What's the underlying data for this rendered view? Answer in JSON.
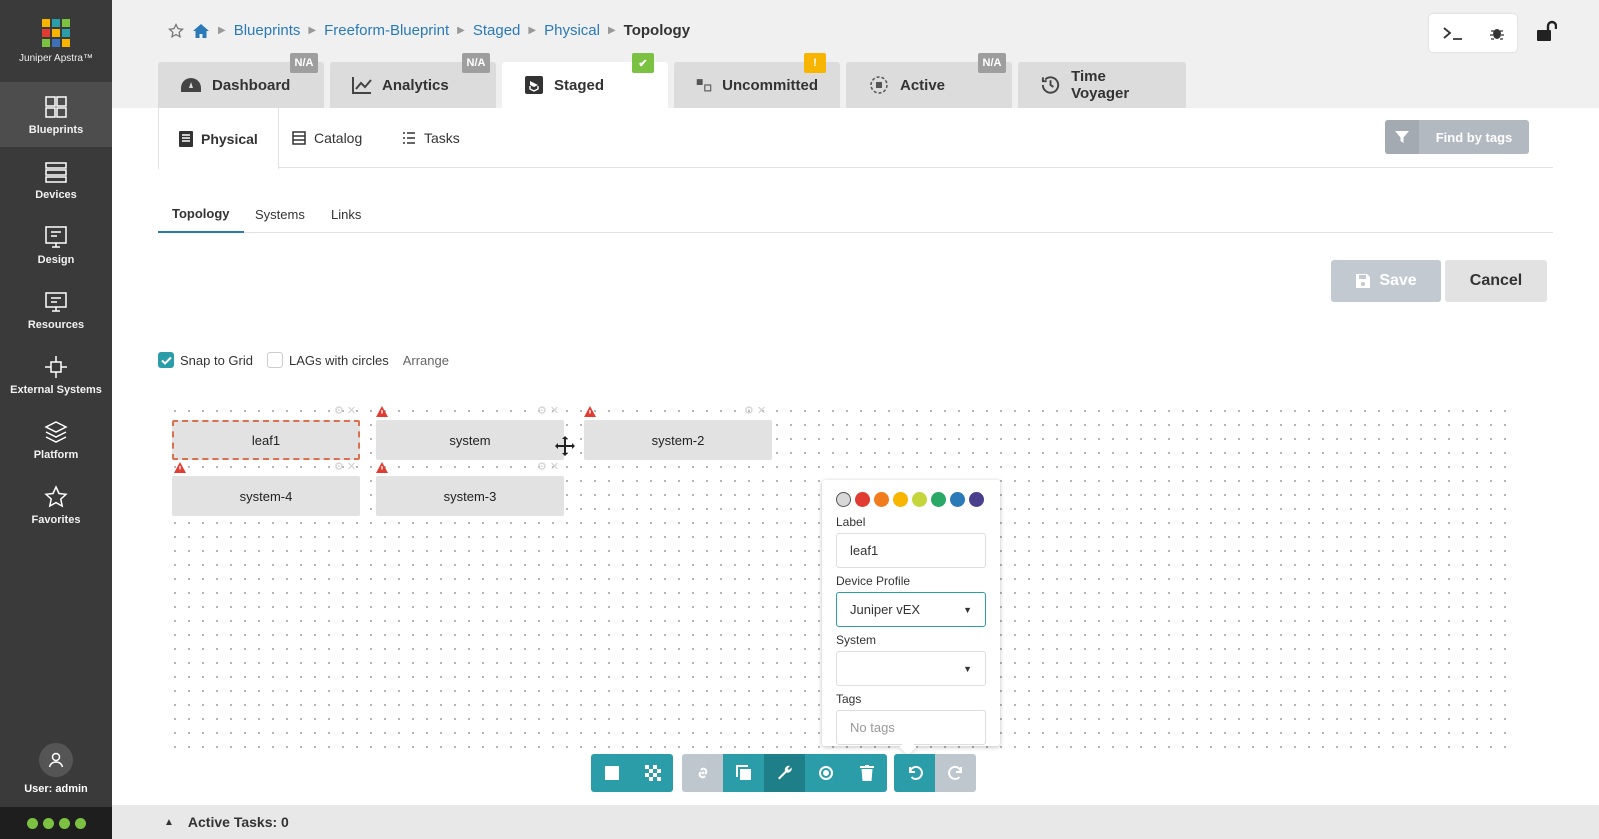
{
  "app": {
    "brand": "Juniper Apstra™",
    "logo_colors": [
      "#f7b500",
      "#2a9da8",
      "#7bc142",
      "#e03c31",
      "#f7b500",
      "#2a9da8",
      "#7bc142",
      "#3f6fb5",
      "#f7b500"
    ]
  },
  "sidebar": {
    "items": [
      {
        "label": "Blueprints",
        "icon": "blueprints-icon"
      },
      {
        "label": "Devices",
        "icon": "devices-icon"
      },
      {
        "label": "Design",
        "icon": "design-icon"
      },
      {
        "label": "Resources",
        "icon": "resources-icon"
      },
      {
        "label": "External Systems",
        "icon": "external-systems-icon"
      },
      {
        "label": "Platform",
        "icon": "platform-icon"
      },
      {
        "label": "Favorites",
        "icon": "star-icon"
      }
    ],
    "user": "User: admin"
  },
  "breadcrumb": {
    "items": [
      "Blueprints",
      "Freeform-Blueprint",
      "Staged",
      "Physical"
    ],
    "current": "Topology"
  },
  "tabs": [
    {
      "label": "Dashboard",
      "badge": "N/A"
    },
    {
      "label": "Analytics",
      "badge": "N/A"
    },
    {
      "label": "Staged",
      "badge": "✔"
    },
    {
      "label": "Uncommitted",
      "badge": "!"
    },
    {
      "label": "Active",
      "badge": "N/A"
    },
    {
      "label": "Time Voyager",
      "badge": ""
    }
  ],
  "subtabs": {
    "physical": "Physical",
    "catalog": "Catalog",
    "tasks": "Tasks",
    "find_tags": "Find by tags"
  },
  "viewtabs": [
    "Topology",
    "Systems",
    "Links"
  ],
  "actions": {
    "save": "Save",
    "cancel": "Cancel"
  },
  "options": {
    "snap_to_grid": "Snap to Grid",
    "snap_checked": true,
    "lags_with_circles": "LAGs with circles",
    "lags_checked": false,
    "arrange": "Arrange"
  },
  "nodes": [
    {
      "label": "leaf1",
      "selected": true
    },
    {
      "label": "system",
      "warning": true
    },
    {
      "label": "system-2",
      "warning": true
    },
    {
      "label": "system-4",
      "warning": true
    },
    {
      "label": "system-3",
      "warning": true
    }
  ],
  "popover": {
    "colors": [
      "#d8d8d8",
      "#e03c31",
      "#f07c1e",
      "#f7b500",
      "#c5d63d",
      "#2aa866",
      "#2a7ab8",
      "#4a3f8c"
    ],
    "label_title": "Label",
    "label_value": "leaf1",
    "device_profile_title": "Device Profile",
    "device_profile_value": "Juniper vEX",
    "system_title": "System",
    "system_value": "",
    "tags_title": "Tags",
    "tags_placeholder": "No tags"
  },
  "footer": {
    "active_tasks": "Active Tasks: 0"
  }
}
